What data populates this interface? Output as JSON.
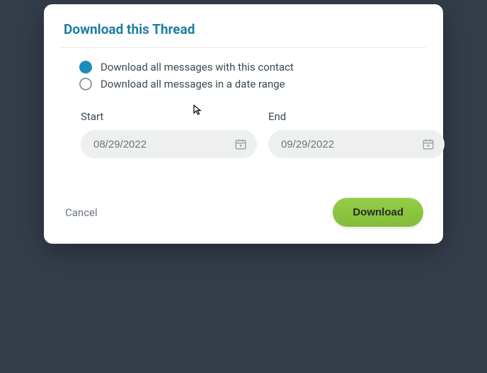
{
  "dialog": {
    "title": "Download this Thread",
    "options": {
      "all_label": "Download all messages with this contact",
      "range_label": "Download all messages in a date range",
      "selected": "all"
    },
    "dates": {
      "start_label": "Start",
      "start_value": "08/29/2022",
      "end_label": "End",
      "end_value": "09/29/2022"
    },
    "actions": {
      "cancel_label": "Cancel",
      "download_label": "Download"
    }
  }
}
